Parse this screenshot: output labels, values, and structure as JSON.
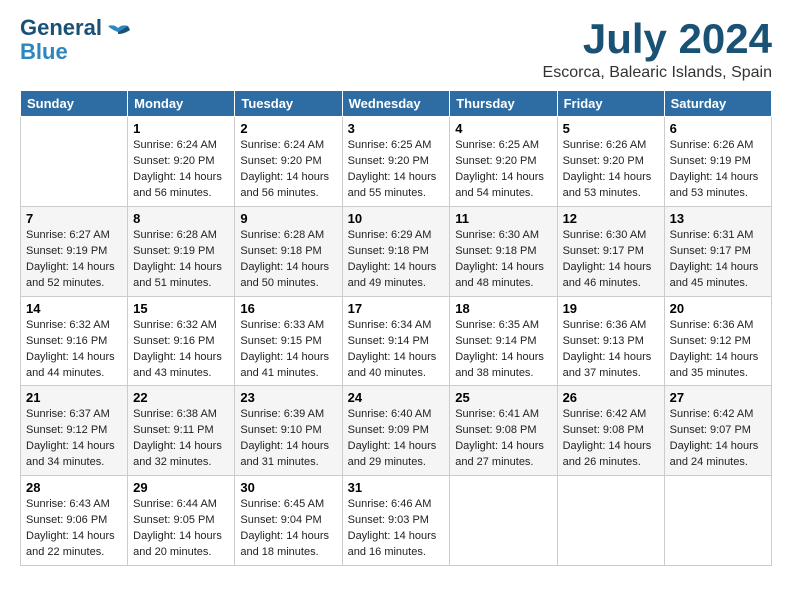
{
  "logo": {
    "line1": "General",
    "line2": "Blue"
  },
  "title": "July 2024",
  "location": "Escorca, Balearic Islands, Spain",
  "weekdays": [
    "Sunday",
    "Monday",
    "Tuesday",
    "Wednesday",
    "Thursday",
    "Friday",
    "Saturday"
  ],
  "weeks": [
    [
      {
        "day": "",
        "sunrise": "",
        "sunset": "",
        "daylight": ""
      },
      {
        "day": "1",
        "sunrise": "Sunrise: 6:24 AM",
        "sunset": "Sunset: 9:20 PM",
        "daylight": "Daylight: 14 hours and 56 minutes."
      },
      {
        "day": "2",
        "sunrise": "Sunrise: 6:24 AM",
        "sunset": "Sunset: 9:20 PM",
        "daylight": "Daylight: 14 hours and 56 minutes."
      },
      {
        "day": "3",
        "sunrise": "Sunrise: 6:25 AM",
        "sunset": "Sunset: 9:20 PM",
        "daylight": "Daylight: 14 hours and 55 minutes."
      },
      {
        "day": "4",
        "sunrise": "Sunrise: 6:25 AM",
        "sunset": "Sunset: 9:20 PM",
        "daylight": "Daylight: 14 hours and 54 minutes."
      },
      {
        "day": "5",
        "sunrise": "Sunrise: 6:26 AM",
        "sunset": "Sunset: 9:20 PM",
        "daylight": "Daylight: 14 hours and 53 minutes."
      },
      {
        "day": "6",
        "sunrise": "Sunrise: 6:26 AM",
        "sunset": "Sunset: 9:19 PM",
        "daylight": "Daylight: 14 hours and 53 minutes."
      }
    ],
    [
      {
        "day": "7",
        "sunrise": "Sunrise: 6:27 AM",
        "sunset": "Sunset: 9:19 PM",
        "daylight": "Daylight: 14 hours and 52 minutes."
      },
      {
        "day": "8",
        "sunrise": "Sunrise: 6:28 AM",
        "sunset": "Sunset: 9:19 PM",
        "daylight": "Daylight: 14 hours and 51 minutes."
      },
      {
        "day": "9",
        "sunrise": "Sunrise: 6:28 AM",
        "sunset": "Sunset: 9:18 PM",
        "daylight": "Daylight: 14 hours and 50 minutes."
      },
      {
        "day": "10",
        "sunrise": "Sunrise: 6:29 AM",
        "sunset": "Sunset: 9:18 PM",
        "daylight": "Daylight: 14 hours and 49 minutes."
      },
      {
        "day": "11",
        "sunrise": "Sunrise: 6:30 AM",
        "sunset": "Sunset: 9:18 PM",
        "daylight": "Daylight: 14 hours and 48 minutes."
      },
      {
        "day": "12",
        "sunrise": "Sunrise: 6:30 AM",
        "sunset": "Sunset: 9:17 PM",
        "daylight": "Daylight: 14 hours and 46 minutes."
      },
      {
        "day": "13",
        "sunrise": "Sunrise: 6:31 AM",
        "sunset": "Sunset: 9:17 PM",
        "daylight": "Daylight: 14 hours and 45 minutes."
      }
    ],
    [
      {
        "day": "14",
        "sunrise": "Sunrise: 6:32 AM",
        "sunset": "Sunset: 9:16 PM",
        "daylight": "Daylight: 14 hours and 44 minutes."
      },
      {
        "day": "15",
        "sunrise": "Sunrise: 6:32 AM",
        "sunset": "Sunset: 9:16 PM",
        "daylight": "Daylight: 14 hours and 43 minutes."
      },
      {
        "day": "16",
        "sunrise": "Sunrise: 6:33 AM",
        "sunset": "Sunset: 9:15 PM",
        "daylight": "Daylight: 14 hours and 41 minutes."
      },
      {
        "day": "17",
        "sunrise": "Sunrise: 6:34 AM",
        "sunset": "Sunset: 9:14 PM",
        "daylight": "Daylight: 14 hours and 40 minutes."
      },
      {
        "day": "18",
        "sunrise": "Sunrise: 6:35 AM",
        "sunset": "Sunset: 9:14 PM",
        "daylight": "Daylight: 14 hours and 38 minutes."
      },
      {
        "day": "19",
        "sunrise": "Sunrise: 6:36 AM",
        "sunset": "Sunset: 9:13 PM",
        "daylight": "Daylight: 14 hours and 37 minutes."
      },
      {
        "day": "20",
        "sunrise": "Sunrise: 6:36 AM",
        "sunset": "Sunset: 9:12 PM",
        "daylight": "Daylight: 14 hours and 35 minutes."
      }
    ],
    [
      {
        "day": "21",
        "sunrise": "Sunrise: 6:37 AM",
        "sunset": "Sunset: 9:12 PM",
        "daylight": "Daylight: 14 hours and 34 minutes."
      },
      {
        "day": "22",
        "sunrise": "Sunrise: 6:38 AM",
        "sunset": "Sunset: 9:11 PM",
        "daylight": "Daylight: 14 hours and 32 minutes."
      },
      {
        "day": "23",
        "sunrise": "Sunrise: 6:39 AM",
        "sunset": "Sunset: 9:10 PM",
        "daylight": "Daylight: 14 hours and 31 minutes."
      },
      {
        "day": "24",
        "sunrise": "Sunrise: 6:40 AM",
        "sunset": "Sunset: 9:09 PM",
        "daylight": "Daylight: 14 hours and 29 minutes."
      },
      {
        "day": "25",
        "sunrise": "Sunrise: 6:41 AM",
        "sunset": "Sunset: 9:08 PM",
        "daylight": "Daylight: 14 hours and 27 minutes."
      },
      {
        "day": "26",
        "sunrise": "Sunrise: 6:42 AM",
        "sunset": "Sunset: 9:08 PM",
        "daylight": "Daylight: 14 hours and 26 minutes."
      },
      {
        "day": "27",
        "sunrise": "Sunrise: 6:42 AM",
        "sunset": "Sunset: 9:07 PM",
        "daylight": "Daylight: 14 hours and 24 minutes."
      }
    ],
    [
      {
        "day": "28",
        "sunrise": "Sunrise: 6:43 AM",
        "sunset": "Sunset: 9:06 PM",
        "daylight": "Daylight: 14 hours and 22 minutes."
      },
      {
        "day": "29",
        "sunrise": "Sunrise: 6:44 AM",
        "sunset": "Sunset: 9:05 PM",
        "daylight": "Daylight: 14 hours and 20 minutes."
      },
      {
        "day": "30",
        "sunrise": "Sunrise: 6:45 AM",
        "sunset": "Sunset: 9:04 PM",
        "daylight": "Daylight: 14 hours and 18 minutes."
      },
      {
        "day": "31",
        "sunrise": "Sunrise: 6:46 AM",
        "sunset": "Sunset: 9:03 PM",
        "daylight": "Daylight: 14 hours and 16 minutes."
      },
      {
        "day": "",
        "sunrise": "",
        "sunset": "",
        "daylight": ""
      },
      {
        "day": "",
        "sunrise": "",
        "sunset": "",
        "daylight": ""
      },
      {
        "day": "",
        "sunrise": "",
        "sunset": "",
        "daylight": ""
      }
    ]
  ]
}
